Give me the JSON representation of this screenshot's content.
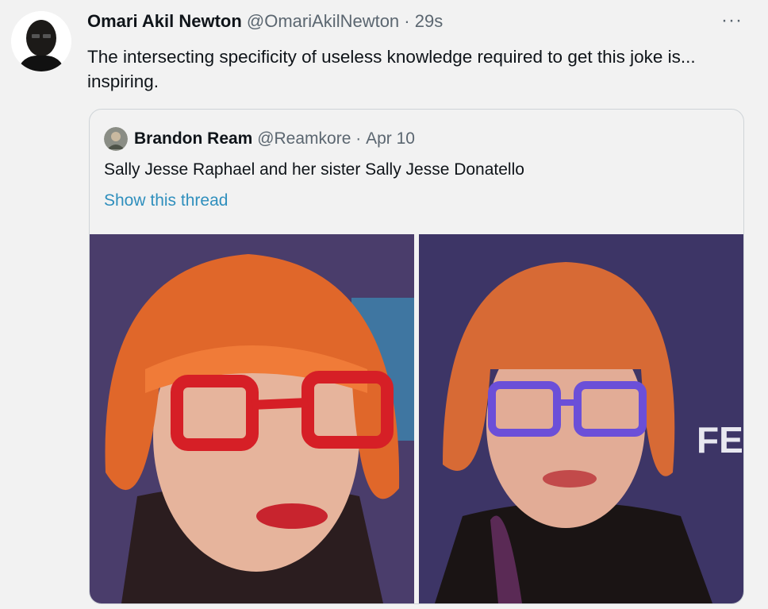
{
  "tweet": {
    "author": {
      "name": "Omari Akil Newton",
      "handle": "@OmariAkilNewton",
      "separator": "·",
      "time": "29s"
    },
    "more_icon": "more-horizontal-icon",
    "text": "The intersecting specificity of useless knowledge required to get this joke is... inspiring."
  },
  "quoted_tweet": {
    "author": {
      "name": "Brandon Ream",
      "handle": "@Reamkore",
      "separator": "·",
      "date": "Apr 10"
    },
    "text": "Sally Jesse Raphael and her sister Sally Jesse Donatello",
    "show_thread": "Show this thread",
    "photos": [
      {
        "glasses_color": "#d61f26",
        "backdrop": "#4a3d6b",
        "sign_text": ""
      },
      {
        "glasses_color": "#6b4fd8",
        "backdrop": "#3d3566",
        "sign_text": "FE"
      }
    ]
  },
  "colors": {
    "background": "#f2f2f2",
    "text": "#0f1419",
    "secondary": "#5b6670",
    "link": "#2f8fbd",
    "hair": "#e0672a"
  }
}
